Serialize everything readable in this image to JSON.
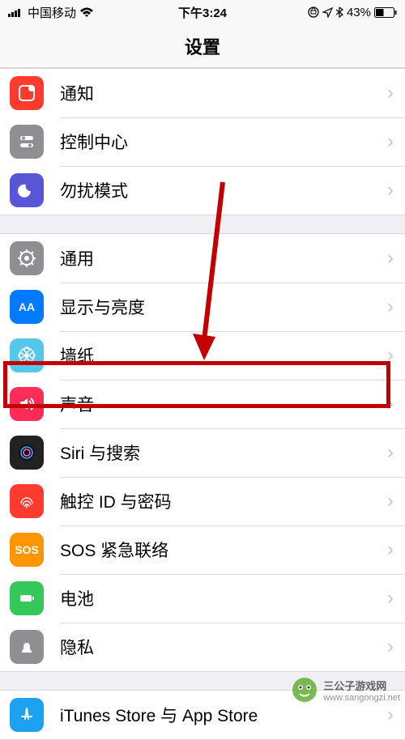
{
  "statusbar": {
    "signal": "▮▮▮▮▮",
    "carrier": "中国移动",
    "wifi": "wifi",
    "time": "下午3:24",
    "lock": "⊕",
    "location": "➤",
    "bt": "bt",
    "battery_pct": "43%",
    "battery": "batt"
  },
  "navbar": {
    "title": "设置"
  },
  "groups": [
    {
      "rows": [
        {
          "key": "notifications",
          "label": "通知",
          "icon": "notification-icon"
        },
        {
          "key": "control-center",
          "label": "控制中心",
          "icon": "control-center-icon"
        },
        {
          "key": "dnd",
          "label": "勿扰模式",
          "icon": "dnd-icon"
        }
      ]
    },
    {
      "rows": [
        {
          "key": "general",
          "label": "通用",
          "icon": "general-icon"
        },
        {
          "key": "display",
          "label": "显示与亮度",
          "icon": "display-icon"
        },
        {
          "key": "wallpaper",
          "label": "墙纸",
          "icon": "wallpaper-icon"
        },
        {
          "key": "sound",
          "label": "声音",
          "icon": "sound-icon",
          "highlighted": true
        },
        {
          "key": "siri",
          "label": "Siri 与搜索",
          "icon": "siri-icon"
        },
        {
          "key": "touchid",
          "label": "触控 ID 与密码",
          "icon": "touchid-icon"
        },
        {
          "key": "sos",
          "label": "SOS 紧急联络",
          "icon": "sos-icon"
        },
        {
          "key": "battery",
          "label": "电池",
          "icon": "battery-icon"
        },
        {
          "key": "privacy",
          "label": "隐私",
          "icon": "privacy-icon"
        }
      ]
    },
    {
      "rows": [
        {
          "key": "itunes-appstore",
          "label": "iTunes Store 与 App Store",
          "icon": "appstore-icon"
        }
      ]
    }
  ],
  "annotation": {
    "arrow_target": "sound",
    "highlight_target": "sound"
  },
  "watermark": {
    "text": "三公子游戏网",
    "url": "www.sangongzi.net"
  }
}
